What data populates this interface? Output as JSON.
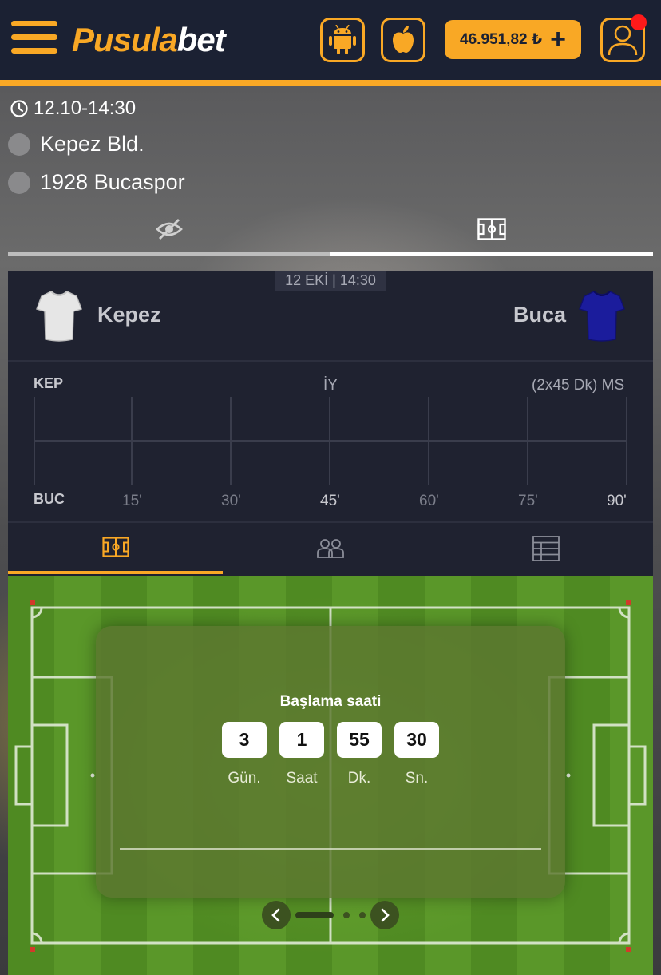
{
  "header": {
    "logo_part1": "Pusula",
    "logo_part2": "bet",
    "balance": "46.951,82 ₺",
    "balance_add": "+",
    "android_icon": "android-icon",
    "apple_icon": "apple-icon",
    "user_icon": "user-icon",
    "accent": "#f9a825",
    "bg": "#1b2133"
  },
  "match": {
    "datetime": "12.10-14:30",
    "home_full": "Kepez Bld.",
    "away_full": "1928 Bucaspor"
  },
  "scoreboard": {
    "date_badge": "12 EKİ | 14:30",
    "home": "Kepez",
    "away": "Buca",
    "home_code": "KEP",
    "away_code": "BUC",
    "half_label": "İY",
    "full_label": "(2x45 Dk) MS",
    "ticks": [
      "15'",
      "30'",
      "45'",
      "60'",
      "75'",
      "90'"
    ]
  },
  "countdown": {
    "title": "Başlama saati",
    "days": "3",
    "hours": "1",
    "minutes": "55",
    "seconds": "30",
    "days_label": "Gün.",
    "hours_label": "Saat",
    "minutes_label": "Dk.",
    "seconds_label": "Sn."
  }
}
